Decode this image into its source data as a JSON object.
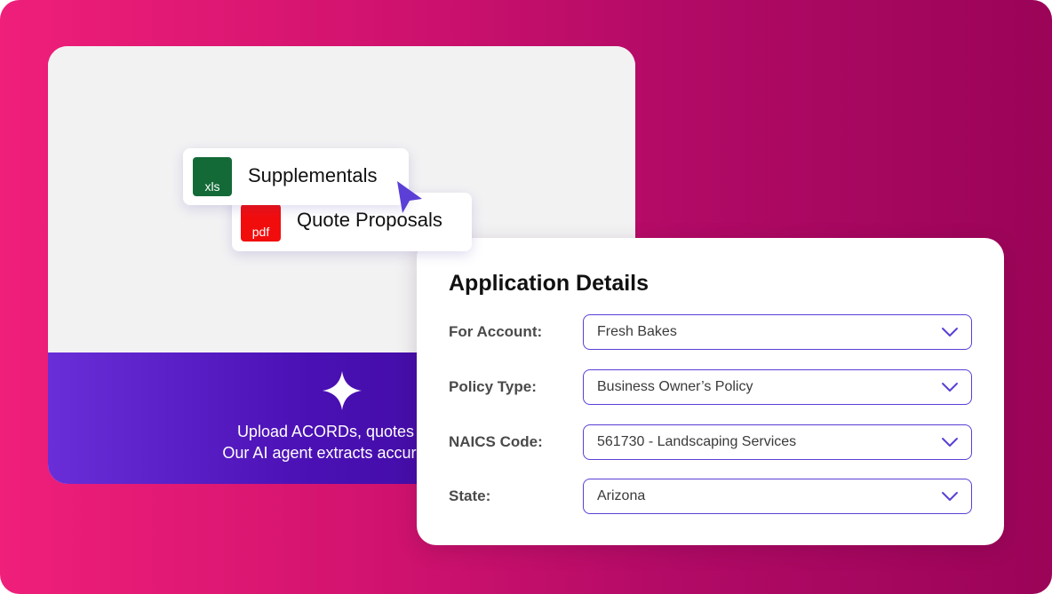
{
  "upload_card": {
    "files": [
      {
        "type_label": "xls",
        "name": "Supplementals",
        "icon": "xls-file-icon",
        "color": "#136a37"
      },
      {
        "type_label": "pdf",
        "name": "Quote Proposals",
        "icon": "pdf-file-icon",
        "color": "#f20d0d"
      }
    ],
    "footer_icon": "sparkle-icon",
    "footer_line_1": "Upload ACORDs, quotes or p",
    "footer_line_2": "Our AI agent extracts accurate da"
  },
  "application_details": {
    "title": "Application Details",
    "fields": [
      {
        "label": "For Account:",
        "value": "Fresh Bakes"
      },
      {
        "label": "Policy Type:",
        "value": "Business Owner’s Policy"
      },
      {
        "label": "NAICS Code:",
        "value": "561730 - Landscaping Services"
      },
      {
        "label": "State:",
        "value": "Arizona"
      }
    ]
  },
  "colors": {
    "background_start": "#ef1f7a",
    "background_end": "#9b0458",
    "accent_purple": "#5b3fd6",
    "footer_purple": "#4a10b4"
  }
}
